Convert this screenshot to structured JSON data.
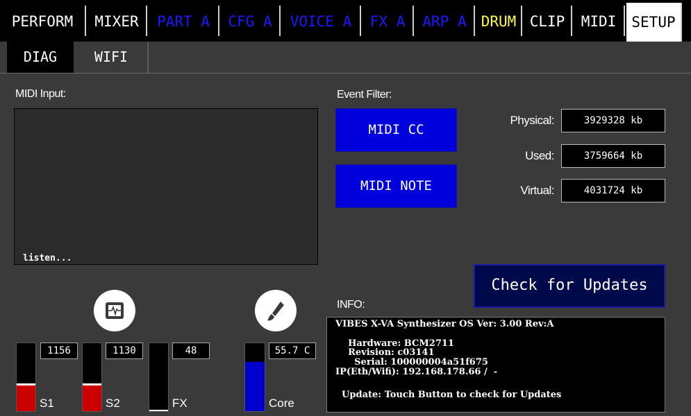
{
  "top_tabs": [
    {
      "label": "PERFORM",
      "color": "white"
    },
    {
      "label": "MIXER",
      "color": "white"
    },
    {
      "label": "PART A",
      "color": "blue"
    },
    {
      "label": "CFG A",
      "color": "blue"
    },
    {
      "label": "VOICE A",
      "color": "blue"
    },
    {
      "label": "FX A",
      "color": "blue"
    },
    {
      "label": "ARP A",
      "color": "blue"
    },
    {
      "label": "DRUM",
      "color": "yellow"
    },
    {
      "label": "CLIP",
      "color": "white"
    },
    {
      "label": "MIDI",
      "color": "white"
    },
    {
      "label": "SETUP",
      "color": "white",
      "active": true
    }
  ],
  "sub_tabs": [
    {
      "label": "DIAG",
      "active": true
    },
    {
      "label": "WIFI",
      "active": false
    }
  ],
  "midi_input": {
    "label": "MIDI Input:",
    "status": "listen..."
  },
  "event_filter": {
    "label": "Event Filter:",
    "cc_button": "MIDI CC",
    "note_button": "MIDI NOTE"
  },
  "memory": {
    "physical_label": "Physical:",
    "physical_value": "3929328 kb",
    "used_label": "Used:",
    "used_value": "3759664 kb",
    "virtual_label": "Virtual:",
    "virtual_value": "4031724 kb"
  },
  "update_button": "Check for Updates",
  "info": {
    "label": "INFO:",
    "line1": "VIBES X-VA Synthesizer OS Ver: 3.00 Rev:A",
    "line2": "    Hardware: BCM2711",
    "line3": "    Revision: c03141",
    "line4": "      Serial: 100000004a51f675",
    "line5": "IP(Eth/Wifi): 192.168.178.66 /  -",
    "line6": "  Update: Touch Button to check for Updates"
  },
  "meters": {
    "s1": {
      "label": "S1",
      "value": "1156",
      "level": 0.38,
      "color": "#cc0000"
    },
    "s2": {
      "label": "S2",
      "value": "1130",
      "level": 0.38,
      "color": "#cc0000"
    },
    "fx": {
      "label": "FX",
      "value": "48",
      "level": 0.02,
      "color": "#ffffff"
    },
    "core": {
      "label": "Core",
      "value": "55.7 C",
      "level": 0.72,
      "color": "#0000cc"
    }
  },
  "icons": {
    "monitor": "pulse-monitor-icon",
    "brush": "brush-icon"
  }
}
